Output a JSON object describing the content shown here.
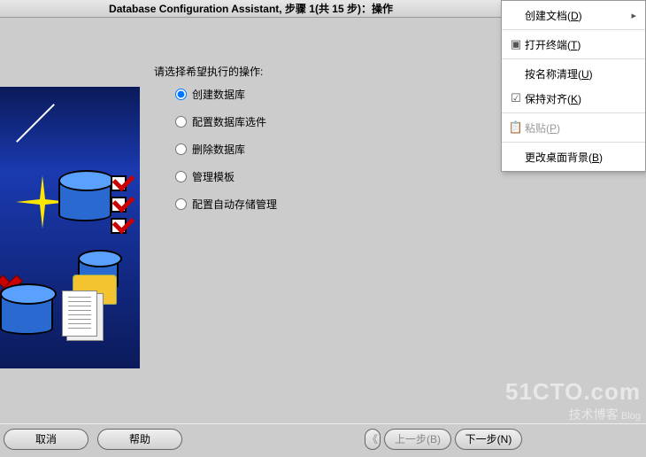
{
  "title": "Database Configuration Assistant, 步骤 1(共 15 步)：操作",
  "prompt_label": "请选择希望执行的操作:",
  "options": [
    {
      "label": "创建数据库",
      "selected": true
    },
    {
      "label": "配置数据库选件",
      "selected": false
    },
    {
      "label": "删除数据库",
      "selected": false
    },
    {
      "label": "管理模板",
      "selected": false
    },
    {
      "label": "配置自动存储管理",
      "selected": false
    }
  ],
  "buttons": {
    "cancel": "取消",
    "help": "帮助",
    "back": "上一步(B)",
    "next": "下一步(N)"
  },
  "context_menu": {
    "create_doc": {
      "label": "创建文档(",
      "acc": "D",
      "suffix": ")"
    },
    "open_term": {
      "label": "打开终端(",
      "acc": "T",
      "suffix": ")"
    },
    "clean_name": {
      "label": "按名称清理(",
      "acc": "U",
      "suffix": ")"
    },
    "keep_align": {
      "label": "保持对齐(",
      "acc": "K",
      "suffix": ")",
      "checked": true
    },
    "paste": {
      "label": "粘贴(",
      "acc": "P",
      "suffix": ")"
    },
    "change_bg": {
      "label": "更改桌面背景(",
      "acc": "B",
      "suffix": ")"
    }
  },
  "watermark": {
    "brand": "51CTO.com",
    "sub": "技术博客",
    "tag": "Blog"
  }
}
